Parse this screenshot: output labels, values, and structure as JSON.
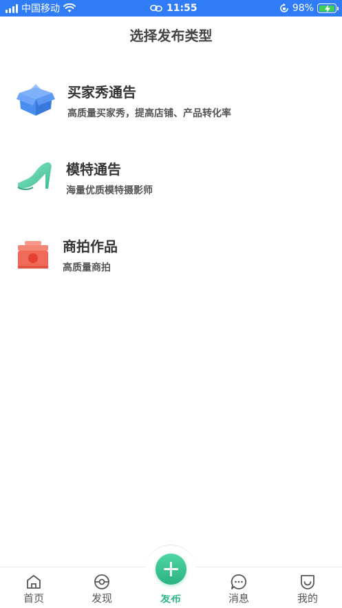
{
  "status_bar": {
    "carrier": "中国移动",
    "time": "11:55",
    "battery_percent": "98%",
    "battery_level": 0.98
  },
  "page": {
    "title": "选择发布类型"
  },
  "options": [
    {
      "title": "买家秀通告",
      "desc": "高质量买家秀，提高店铺、产品转化率",
      "icon": "open-box-icon"
    },
    {
      "title": "模特通告",
      "desc": "海量优质模特摄影师",
      "icon": "high-heel-icon"
    },
    {
      "title": "商拍作品",
      "desc": "高质量商拍",
      "icon": "product-box-icon"
    }
  ],
  "tabbar": {
    "items": [
      {
        "label": "首页",
        "icon": "home-icon"
      },
      {
        "label": "发现",
        "icon": "discover-icon"
      },
      {
        "label": "发布",
        "icon": "plus-icon",
        "active": true
      },
      {
        "label": "消息",
        "icon": "message-icon"
      },
      {
        "label": "我的",
        "icon": "profile-icon"
      }
    ]
  },
  "colors": {
    "status_bar": "#2f7cf6",
    "accent": "#30b88a",
    "box_blue": "#4a8ef0",
    "heel_green": "#5fd3b0",
    "box_red": "#f06a5a"
  }
}
